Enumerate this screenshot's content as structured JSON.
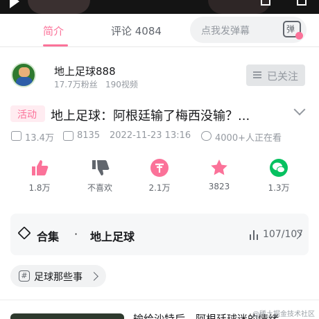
{
  "tabs": [
    {
      "label": "简介",
      "active": true
    },
    {
      "label": "评论 4084",
      "active": false
    }
  ],
  "danmaku": {
    "placeholder": "点我发弹幕",
    "button_label": "弹"
  },
  "uploader": {
    "name": "地上足球888",
    "fans": "17.7万粉丝",
    "videos": "190视频",
    "follow_label": "已关注"
  },
  "video": {
    "tag": "活动",
    "title": "地上足球：阿根廷输了梅西没输？...",
    "stats": {
      "views": "13.4万",
      "danmaku": "8135",
      "date": "2022-11-23 13:16",
      "watching": "4000+人正在看"
    }
  },
  "actions": [
    {
      "name": "like",
      "count": "1.8万"
    },
    {
      "name": "dislike",
      "count": "不喜欢"
    },
    {
      "name": "coin",
      "count": "2.1万"
    },
    {
      "name": "favorite",
      "count": "3823"
    },
    {
      "name": "share",
      "count": "1.3万"
    }
  ],
  "collection": {
    "label": "合集",
    "separator": "·",
    "name": "地上足球",
    "progress": "107/107"
  },
  "topic": {
    "label": "足球那些事"
  },
  "related": {
    "title": "输给沙特后，阿根廷球迷的情绪..."
  },
  "watermark": "@稀土掘金技术社区",
  "colors": {
    "accent": "#fb7299",
    "like": "#fb7299",
    "dislike": "#61666d",
    "coin": "#fb7299",
    "favorite": "#fb7299",
    "share": "#07c160"
  }
}
